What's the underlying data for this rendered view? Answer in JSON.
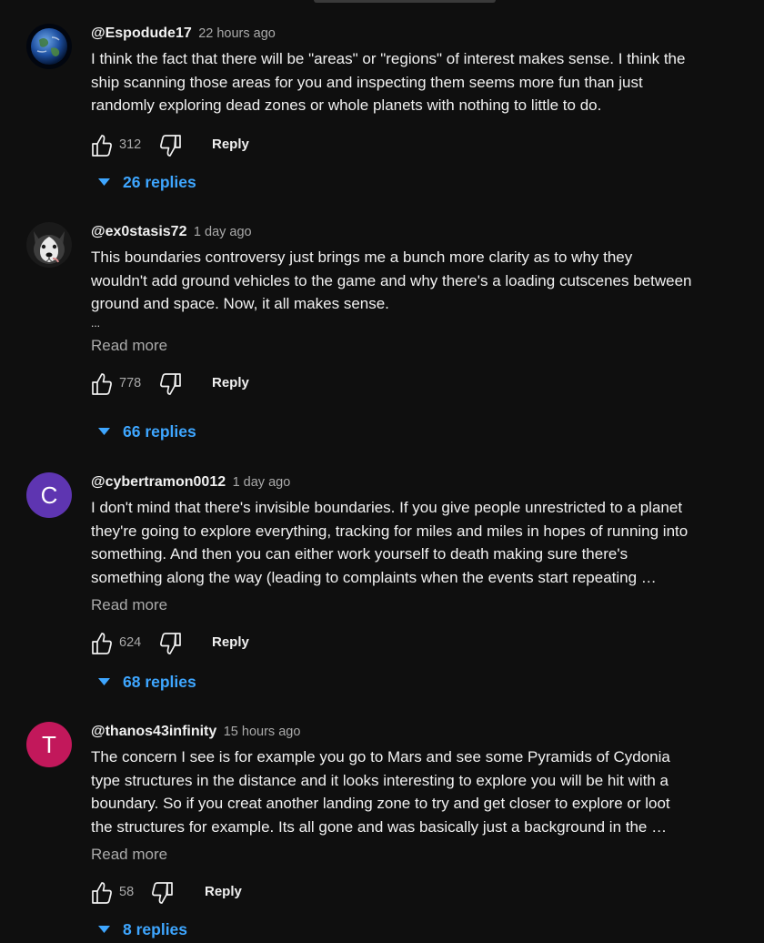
{
  "comments": [
    {
      "author": "@Espodude17",
      "time": "22 hours ago",
      "avatar": "earth-globe-avatar",
      "text": "I think the fact that there will be \"areas\" or \"regions\" of interest makes sense. I think the\nship scanning those areas for you and inspecting them seems more fun than just\nrandomly exploring dead zones or whole planets with nothing to little to do.",
      "likes": "312",
      "reply_label": "Reply",
      "replies_label": "26 replies"
    },
    {
      "author": "@ex0stasis72",
      "time": "1 day ago",
      "avatar": "husky-dog-avatar",
      "text": "This boundaries controversy just brings me a bunch more clarity as to why they\nwouldn't add ground vehicles to the game and why there's a loading cutscenes between\nground and space. Now, it all makes sense.",
      "ellipsis": "...",
      "read_more": "Read more",
      "likes": "778",
      "reply_label": "Reply",
      "replies_label": "66 replies"
    },
    {
      "author": "@cybertramon0012",
      "time": "1 day ago",
      "avatar_letter": "C",
      "avatar_color": "#5e35b1",
      "text": "I don't mind that there's invisible boundaries. If you give people unrestricted to a planet\nthey're going to explore everything, tracking for miles and miles in hopes of running into\nsomething. And then you can either work yourself to death making sure there's\nsomething along the way (leading to complaints when the events start repeating …",
      "read_more": "Read more",
      "likes": "624",
      "reply_label": "Reply",
      "replies_label": "68 replies"
    },
    {
      "author": "@thanos43infinity",
      "time": "15 hours ago",
      "avatar_letter": "T",
      "avatar_color": "#c2185b",
      "text": "The concern I see is for example you go to Mars and see some Pyramids of Cydonia\ntype structures in the distance and it looks interesting to explore you will be hit with a\nboundary. So if you creat another landing zone to try and get closer to explore or loot\nthe structures for example. Its all gone and was basically just a background in the …",
      "read_more": "Read more",
      "likes": "58",
      "reply_label": "Reply",
      "replies_label": "8 replies"
    }
  ],
  "colors": {
    "background": "#0f0f0f",
    "text": "#f1f1f1",
    "secondary_text": "#aaaaaa",
    "link_blue": "#3ea6ff"
  }
}
